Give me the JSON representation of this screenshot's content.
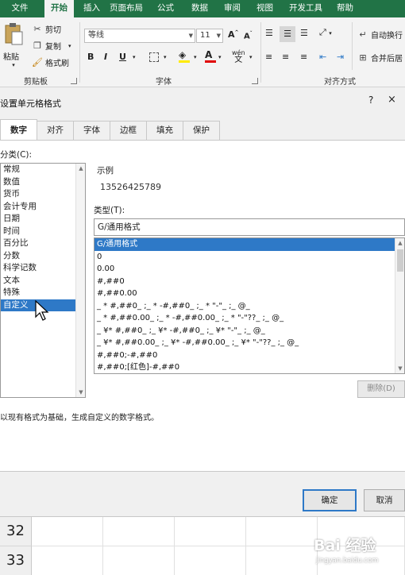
{
  "ribbon": {
    "tabs": [
      "文件",
      "开始",
      "插入",
      "页面布局",
      "公式",
      "数据",
      "审阅",
      "视图",
      "开发工具",
      "帮助"
    ],
    "active_tab": "开始",
    "clipboard": {
      "paste": "粘贴",
      "cut": "剪切",
      "copy": "复制",
      "format_painter": "格式刷",
      "group_label": "剪贴板"
    },
    "font": {
      "font_name": "等线",
      "font_size": "11",
      "bold": "B",
      "italic": "I",
      "underline": "U",
      "group_label": "字体",
      "wen": "wén"
    },
    "align": {
      "wrap_text": "自动换行",
      "merge_center": "合并后居",
      "group_label": "对齐方式"
    }
  },
  "dialog": {
    "title": "设置单元格格式",
    "help": "?",
    "close": "×",
    "tabs": [
      "数字",
      "对齐",
      "字体",
      "边框",
      "填充",
      "保护"
    ],
    "active_tab": "数字",
    "category_label": "分类(C):",
    "categories": [
      "常规",
      "数值",
      "货币",
      "会计专用",
      "日期",
      "时间",
      "百分比",
      "分数",
      "科学记数",
      "文本",
      "特殊",
      "自定义"
    ],
    "selected_category": "自定义",
    "sample_label": "示例",
    "sample_value": "13526425789",
    "type_label": "类型(T):",
    "type_value": "G/通用格式",
    "formats": [
      "G/通用格式",
      "0",
      "0.00",
      "#,##0",
      "#,##0.00",
      "_ * #,##0_ ;_ * -#,##0_ ;_ * \"-\"_ ;_ @_",
      "_ * #,##0.00_ ;_ * -#,##0.00_ ;_ * \"-\"??_ ;_ @_",
      "_ ¥* #,##0_ ;_ ¥* -#,##0_ ;_ ¥* \"-\"_ ;_ @_",
      "_ ¥* #,##0.00_ ;_ ¥* -#,##0.00_ ;_ ¥* \"-\"??_ ;_ @_",
      "#,##0;-#,##0",
      "#,##0;[红色]-#,##0"
    ],
    "selected_format": "G/通用格式",
    "delete_button": "删除(D)",
    "description": "以现有格式为基础，生成自定义的数字格式。",
    "ok_button": "确定",
    "cancel_button": "取消"
  },
  "sheet": {
    "rows": [
      "32",
      "33"
    ]
  },
  "watermark": {
    "brand": "Bai 经验",
    "url": "jingyan.baidu.com"
  },
  "colors": {
    "excel_green": "#217346",
    "selection_blue": "#2e79c7"
  }
}
